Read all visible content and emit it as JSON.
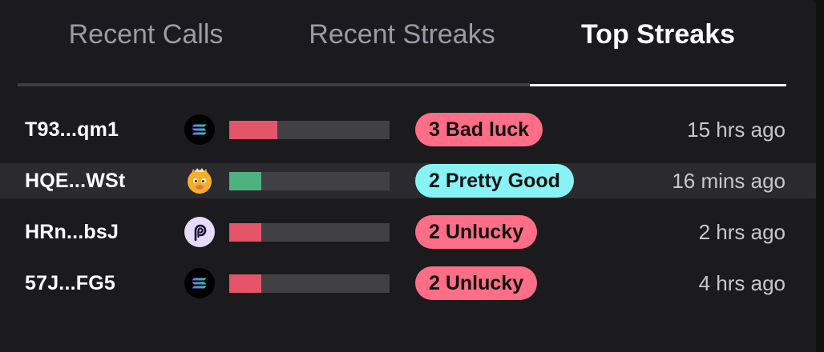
{
  "tabs": [
    {
      "label": "Recent Calls",
      "active": false
    },
    {
      "label": "Recent Streaks",
      "active": false
    },
    {
      "label": "Top Streaks",
      "active": true
    }
  ],
  "colors": {
    "bad": "#e4556a",
    "good": "#4eb27f",
    "pill_bad": "#ff6e86",
    "pill_good": "#88f3f5"
  },
  "rows": [
    {
      "address": "T93...qm1",
      "token_icon": "solana-icon",
      "streak_fraction": 0.3,
      "streak_kind": "bad",
      "badge": "3 Bad luck",
      "time": "15 hrs ago",
      "highlighted": false
    },
    {
      "address": "HQE...WSt",
      "token_icon": "cat-meme-icon",
      "streak_fraction": 0.2,
      "streak_kind": "good",
      "badge": "2 Pretty Good",
      "time": "16 mins ago",
      "highlighted": true
    },
    {
      "address": "HRn...bsJ",
      "token_icon": "pyth-icon",
      "streak_fraction": 0.2,
      "streak_kind": "bad",
      "badge": "2 Unlucky",
      "time": "2 hrs ago",
      "highlighted": false
    },
    {
      "address": "57J...FG5",
      "token_icon": "solana-icon",
      "streak_fraction": 0.2,
      "streak_kind": "bad",
      "badge": "2 Unlucky",
      "time": "4 hrs ago",
      "highlighted": false
    }
  ]
}
